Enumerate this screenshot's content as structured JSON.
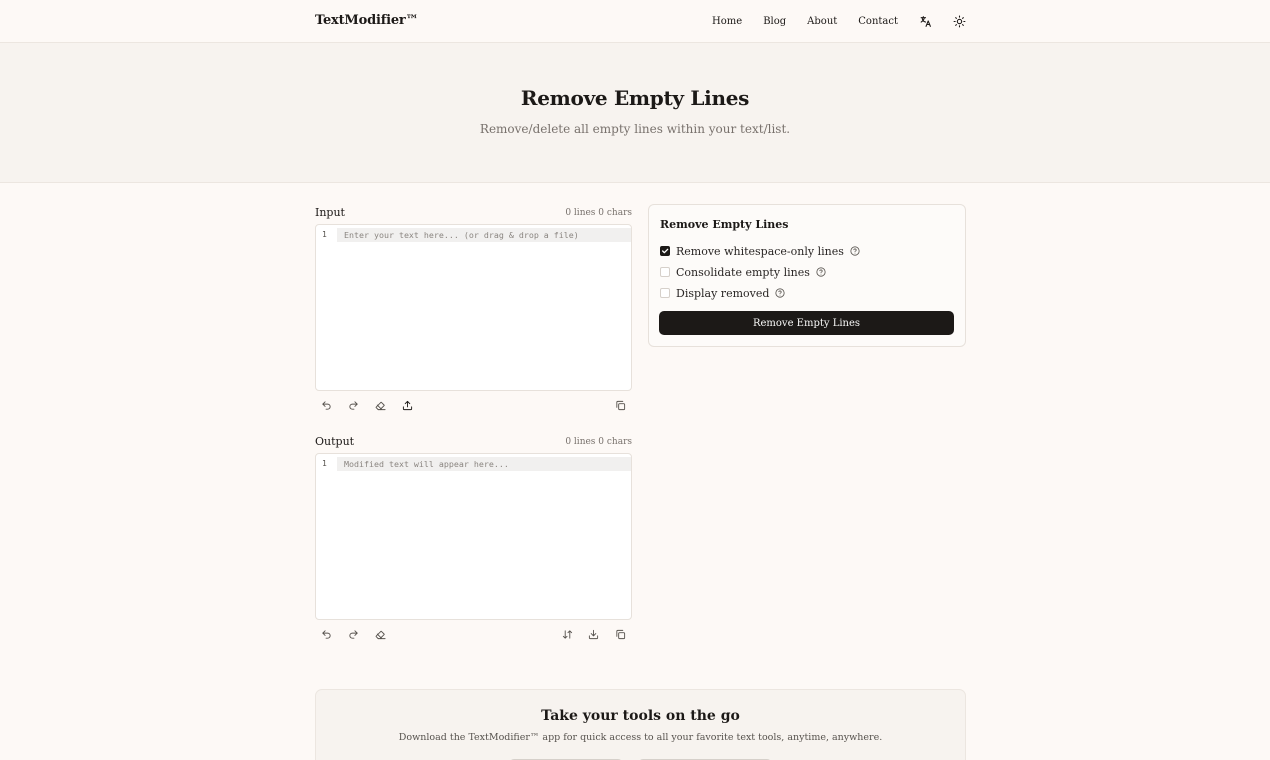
{
  "brand": "TextModifier™",
  "nav": {
    "items": [
      "Home",
      "Blog",
      "About",
      "Contact"
    ],
    "translate_icon": "translate-icon",
    "theme_icon": "sun-icon"
  },
  "hero": {
    "title": "Remove Empty Lines",
    "subtitle": "Remove/delete all empty lines within your text/list."
  },
  "input": {
    "label": "Input",
    "stats": "0 lines  0 chars",
    "line_number": "1",
    "placeholder": "Enter your text here... (or drag & drop a file)",
    "tools": [
      "undo-icon",
      "redo-icon",
      "eraser-icon",
      "upload-icon",
      "copy-icon"
    ]
  },
  "output": {
    "label": "Output",
    "stats": "0 lines  0 chars",
    "line_number": "1",
    "placeholder": "Modified text will appear here...",
    "tools": [
      "undo-icon",
      "redo-icon",
      "eraser-icon",
      "swap-icon",
      "download-icon",
      "copy-icon"
    ]
  },
  "options": {
    "title": "Remove Empty Lines",
    "items": [
      {
        "label": "Remove whitespace-only lines",
        "checked": true
      },
      {
        "label": "Consolidate empty lines",
        "checked": false
      },
      {
        "label": "Display removed",
        "checked": false
      }
    ],
    "button": "Remove Empty Lines"
  },
  "promo": {
    "title": "Take your tools on the go",
    "text": "Download the TextModifier™ app for quick access to all your favorite text tools, anytime, anywhere."
  }
}
